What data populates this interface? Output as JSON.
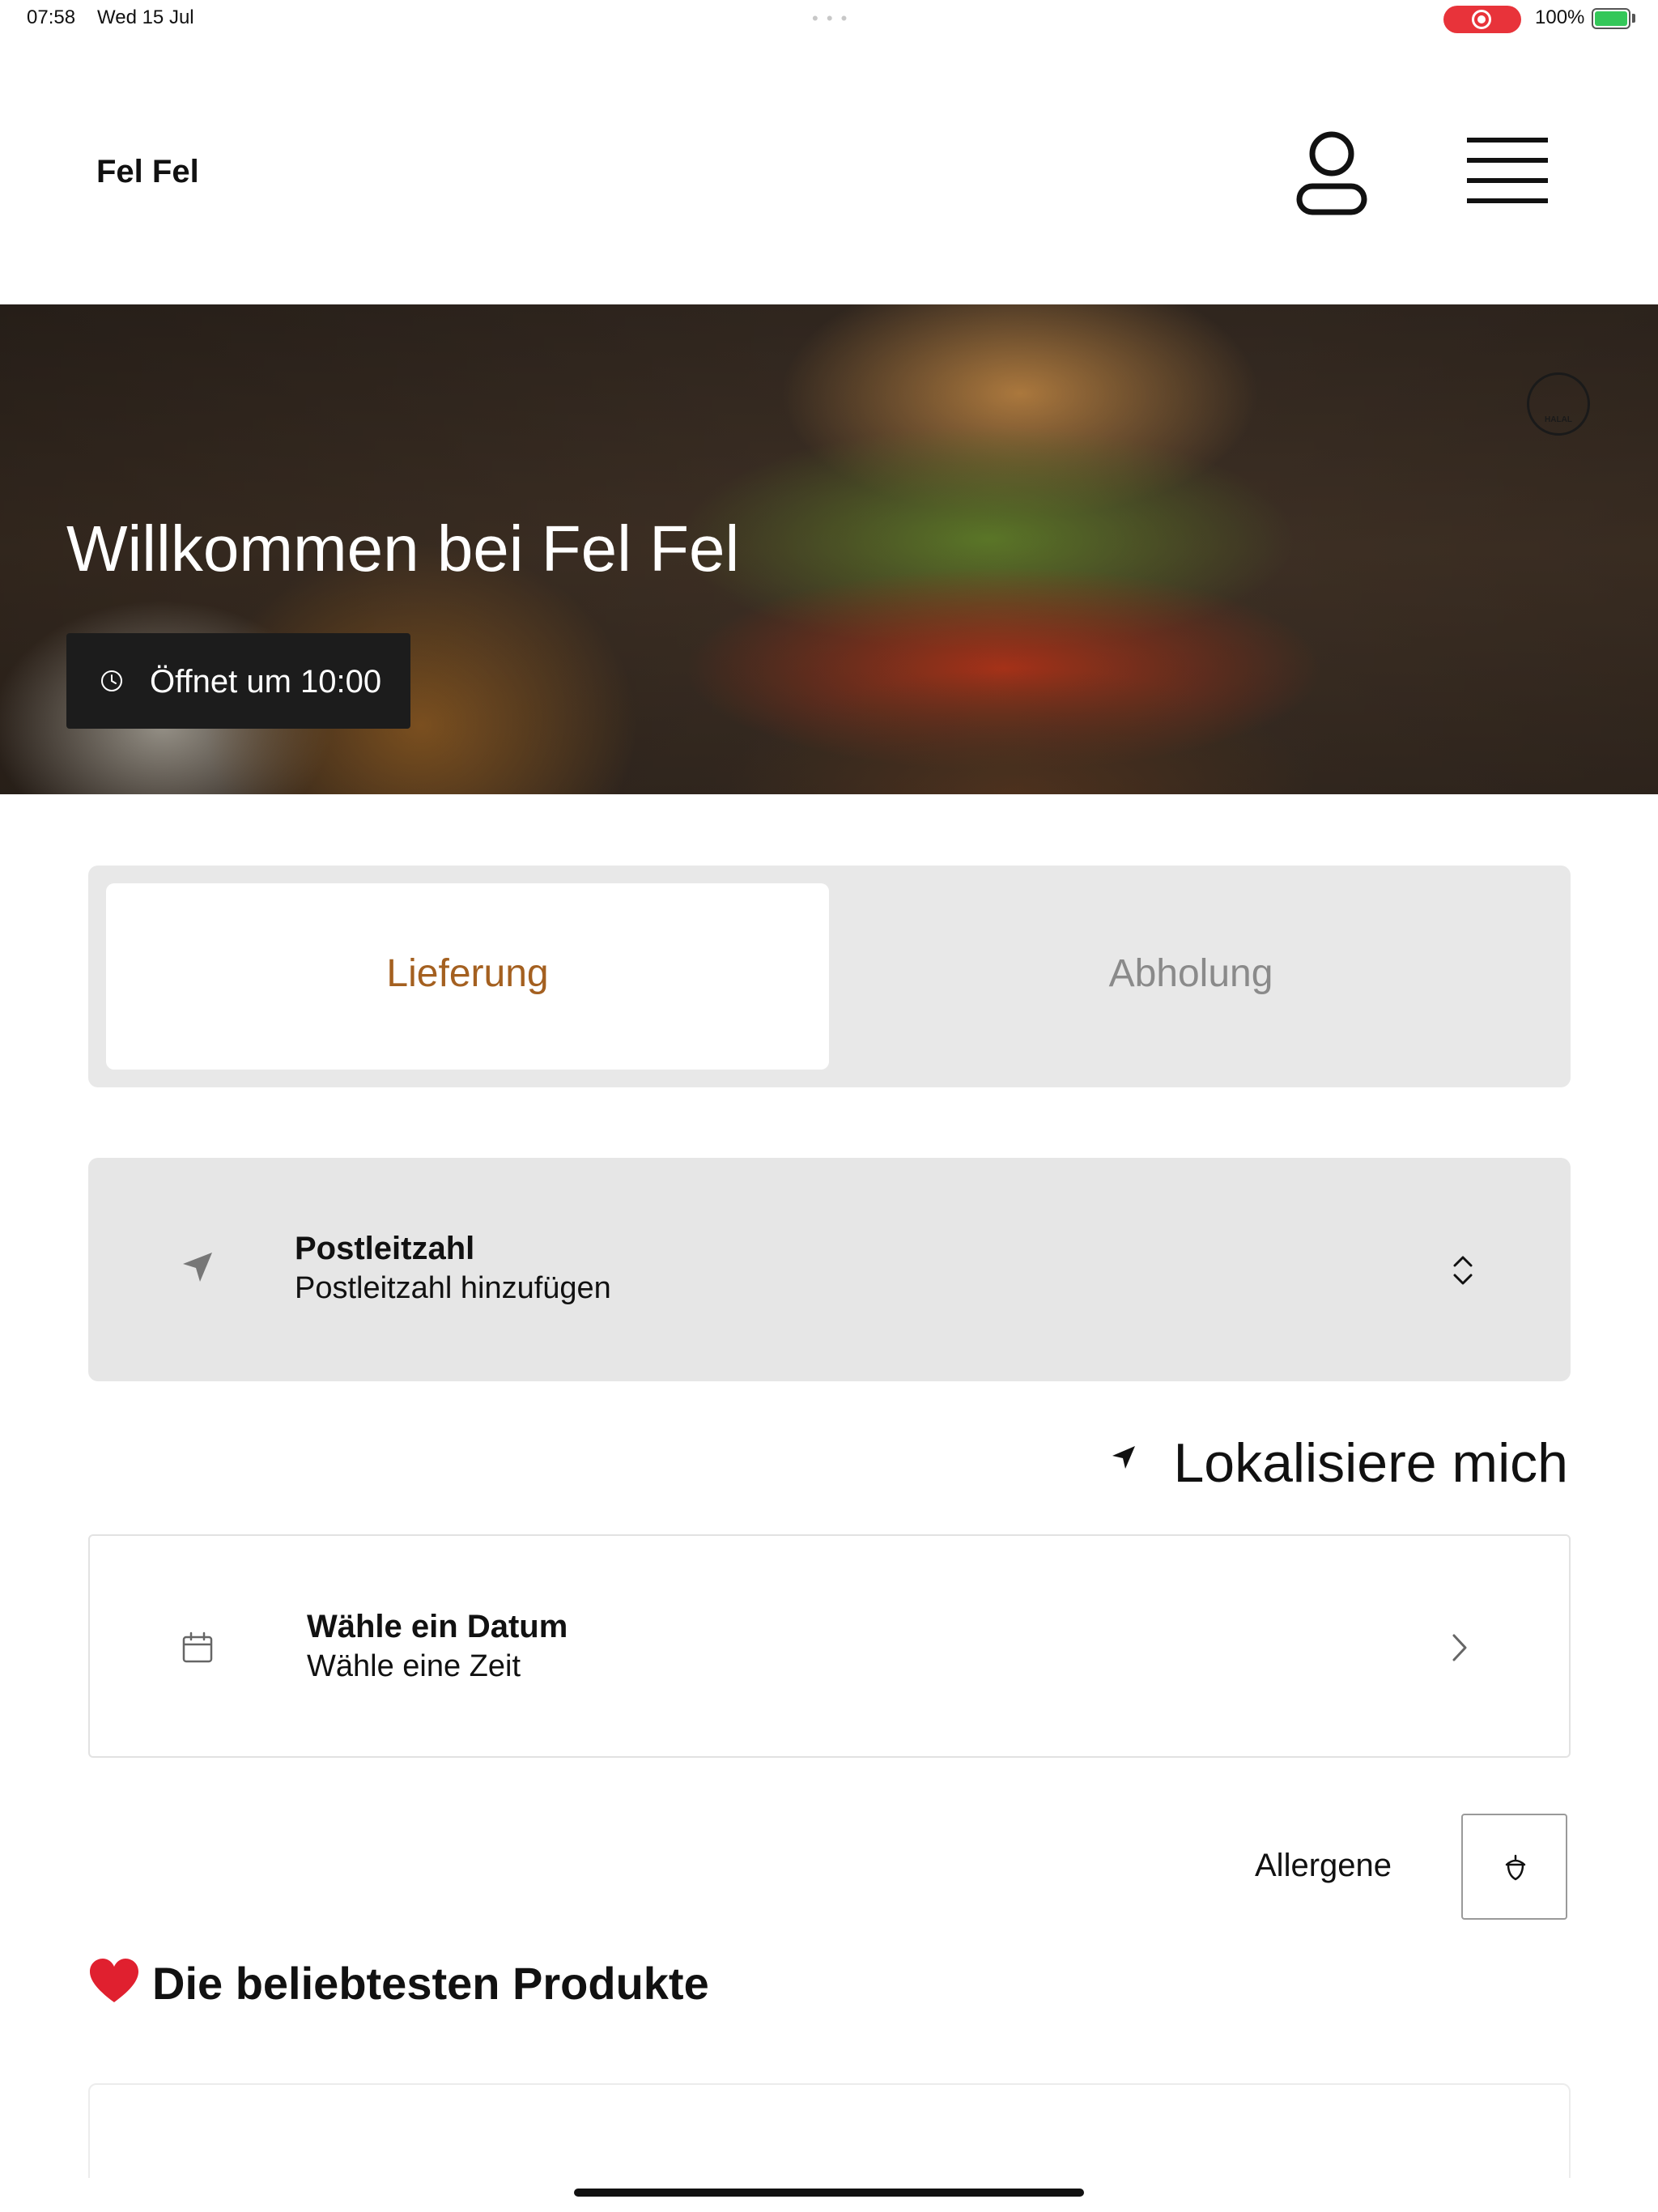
{
  "status_bar": {
    "time": "07:58",
    "date": "Wed 15 Jul",
    "battery_percent": "100%",
    "recording_color": "#e8333a",
    "battery_color": "#34c759"
  },
  "header": {
    "title": "Fel Fel",
    "profile_icon": "user-icon",
    "menu_icon": "hamburger-menu-icon"
  },
  "hero": {
    "title": "Willkommen bei Fel Fel",
    "opening_text": "Öffnet um 10:00",
    "badge_icon": "halal-badge-icon",
    "badge_text": "HALAL"
  },
  "order_type": {
    "options": [
      {
        "label": "Lieferung",
        "selected": true
      },
      {
        "label": "Abholung",
        "selected": false
      }
    ],
    "accent_color": "#a46020"
  },
  "postal_code": {
    "title": "Postleitzahl",
    "subtitle": "Postleitzahl hinzufügen"
  },
  "locate": {
    "label": "Lokalisiere mich"
  },
  "date_picker": {
    "title": "Wähle ein Datum",
    "subtitle": "Wähle eine Zeit"
  },
  "allergens": {
    "label": "Allergene"
  },
  "popular": {
    "title": "Die beliebtesten Produkte",
    "icon": "heart-icon"
  }
}
